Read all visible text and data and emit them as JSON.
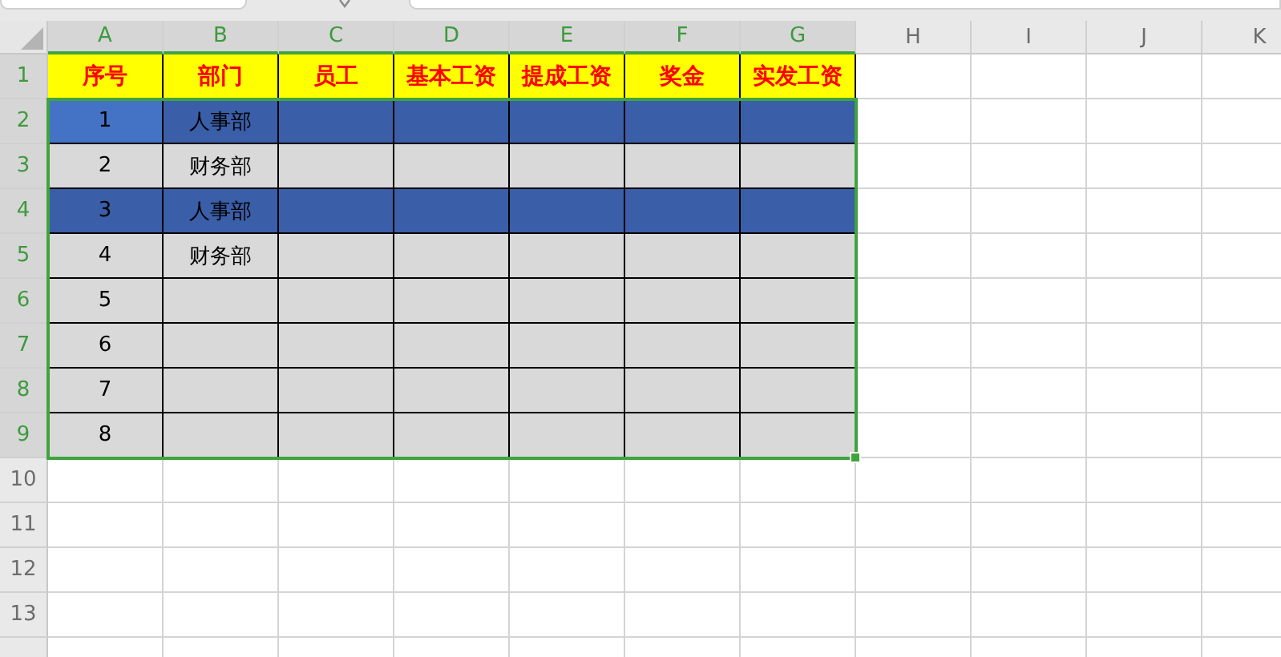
{
  "columns": [
    {
      "label": "A",
      "selected": true
    },
    {
      "label": "B",
      "selected": true
    },
    {
      "label": "C",
      "selected": true
    },
    {
      "label": "D",
      "selected": true
    },
    {
      "label": "E",
      "selected": true
    },
    {
      "label": "F",
      "selected": true
    },
    {
      "label": "G",
      "selected": true
    },
    {
      "label": "H",
      "selected": false
    },
    {
      "label": "I",
      "selected": false
    },
    {
      "label": "J",
      "selected": false
    },
    {
      "label": "K",
      "selected": false
    }
  ],
  "header_row": {
    "header": "1",
    "selected": true,
    "cells": [
      "序号",
      "部门",
      "员工",
      "基本工资",
      "提成工资",
      "奖金",
      "实发工资"
    ]
  },
  "rows": [
    {
      "header": "2",
      "selected": true,
      "highlighted": true,
      "cursor": true,
      "values": [
        "1",
        "人事部"
      ]
    },
    {
      "header": "3",
      "selected": true,
      "highlighted": false,
      "cursor": false,
      "values": [
        "2",
        "财务部"
      ]
    },
    {
      "header": "4",
      "selected": true,
      "highlighted": true,
      "cursor": false,
      "values": [
        "3",
        "人事部"
      ]
    },
    {
      "header": "5",
      "selected": true,
      "highlighted": false,
      "cursor": false,
      "values": [
        "4",
        "财务部"
      ]
    },
    {
      "header": "6",
      "selected": true,
      "highlighted": false,
      "cursor": false,
      "values": [
        "5"
      ]
    },
    {
      "header": "7",
      "selected": true,
      "highlighted": false,
      "cursor": false,
      "values": [
        "6"
      ]
    },
    {
      "header": "8",
      "selected": true,
      "highlighted": false,
      "cursor": false,
      "values": [
        "7"
      ]
    },
    {
      "header": "9",
      "selected": true,
      "highlighted": false,
      "cursor": false,
      "values": [
        "8"
      ]
    }
  ],
  "empty_rows": [
    {
      "header": "10"
    },
    {
      "header": "11"
    },
    {
      "header": "12"
    },
    {
      "header": "13"
    }
  ]
}
